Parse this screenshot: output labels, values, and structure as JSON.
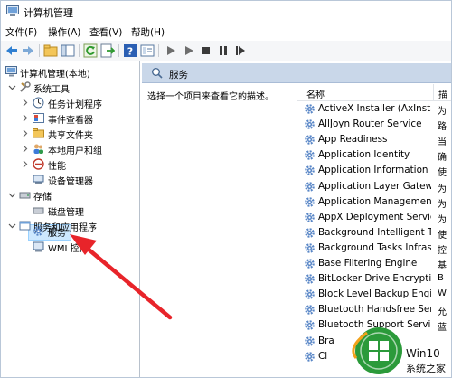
{
  "window": {
    "title": "计算机管理"
  },
  "menu": [
    "文件(F)",
    "操作(A)",
    "查看(V)",
    "帮助(H)"
  ],
  "tree": {
    "root": "计算机管理(本地)",
    "system_tools": "系统工具",
    "task_scheduler": "任务计划程序",
    "event_viewer": "事件查看器",
    "shared_folders": "共享文件夹",
    "local_users": "本地用户和组",
    "performance": "性能",
    "device_manager": "设备管理器",
    "storage": "存储",
    "disk_management": "磁盘管理",
    "services_apps": "服务和应用程序",
    "services": "服务",
    "wmi": "WMI 控件"
  },
  "panel": {
    "header": "服务",
    "description_hint": "选择一个项目来查看它的描述。",
    "col_name": "名称",
    "col_desc": "描"
  },
  "services": [
    {
      "name": "ActiveX Installer (AxInstSV)",
      "desc": "为"
    },
    {
      "name": "AllJoyn Router Service",
      "desc": "路"
    },
    {
      "name": "App Readiness",
      "desc": "当"
    },
    {
      "name": "Application Identity",
      "desc": "确"
    },
    {
      "name": "Application Information",
      "desc": "使"
    },
    {
      "name": "Application Layer Gateway...",
      "desc": "为"
    },
    {
      "name": "Application Management",
      "desc": "为"
    },
    {
      "name": "AppX Deployment Service...",
      "desc": "为"
    },
    {
      "name": "Background Intelligent T...",
      "desc": "使"
    },
    {
      "name": "Background Tasks Infras...",
      "desc": "控"
    },
    {
      "name": "Base Filtering Engine",
      "desc": "基"
    },
    {
      "name": "BitLocker Drive Encryptio...",
      "desc": "B"
    },
    {
      "name": "Block Level Backup Engi...",
      "desc": "W"
    },
    {
      "name": "Bluetooth Handsfree Ser...",
      "desc": "允"
    },
    {
      "name": "Bluetooth Support Service",
      "desc": "蓝"
    },
    {
      "name": "Bra",
      "desc": ""
    },
    {
      "name": "Cl",
      "desc": ""
    }
  ],
  "watermark": {
    "brand": "Win10",
    "sub": "系统之家",
    "faint": "PCs"
  },
  "colors": {
    "selection": "#cde8ff",
    "header": "#c9d7e9",
    "arrow": "#e8242a",
    "gear": "#5a87c7"
  }
}
